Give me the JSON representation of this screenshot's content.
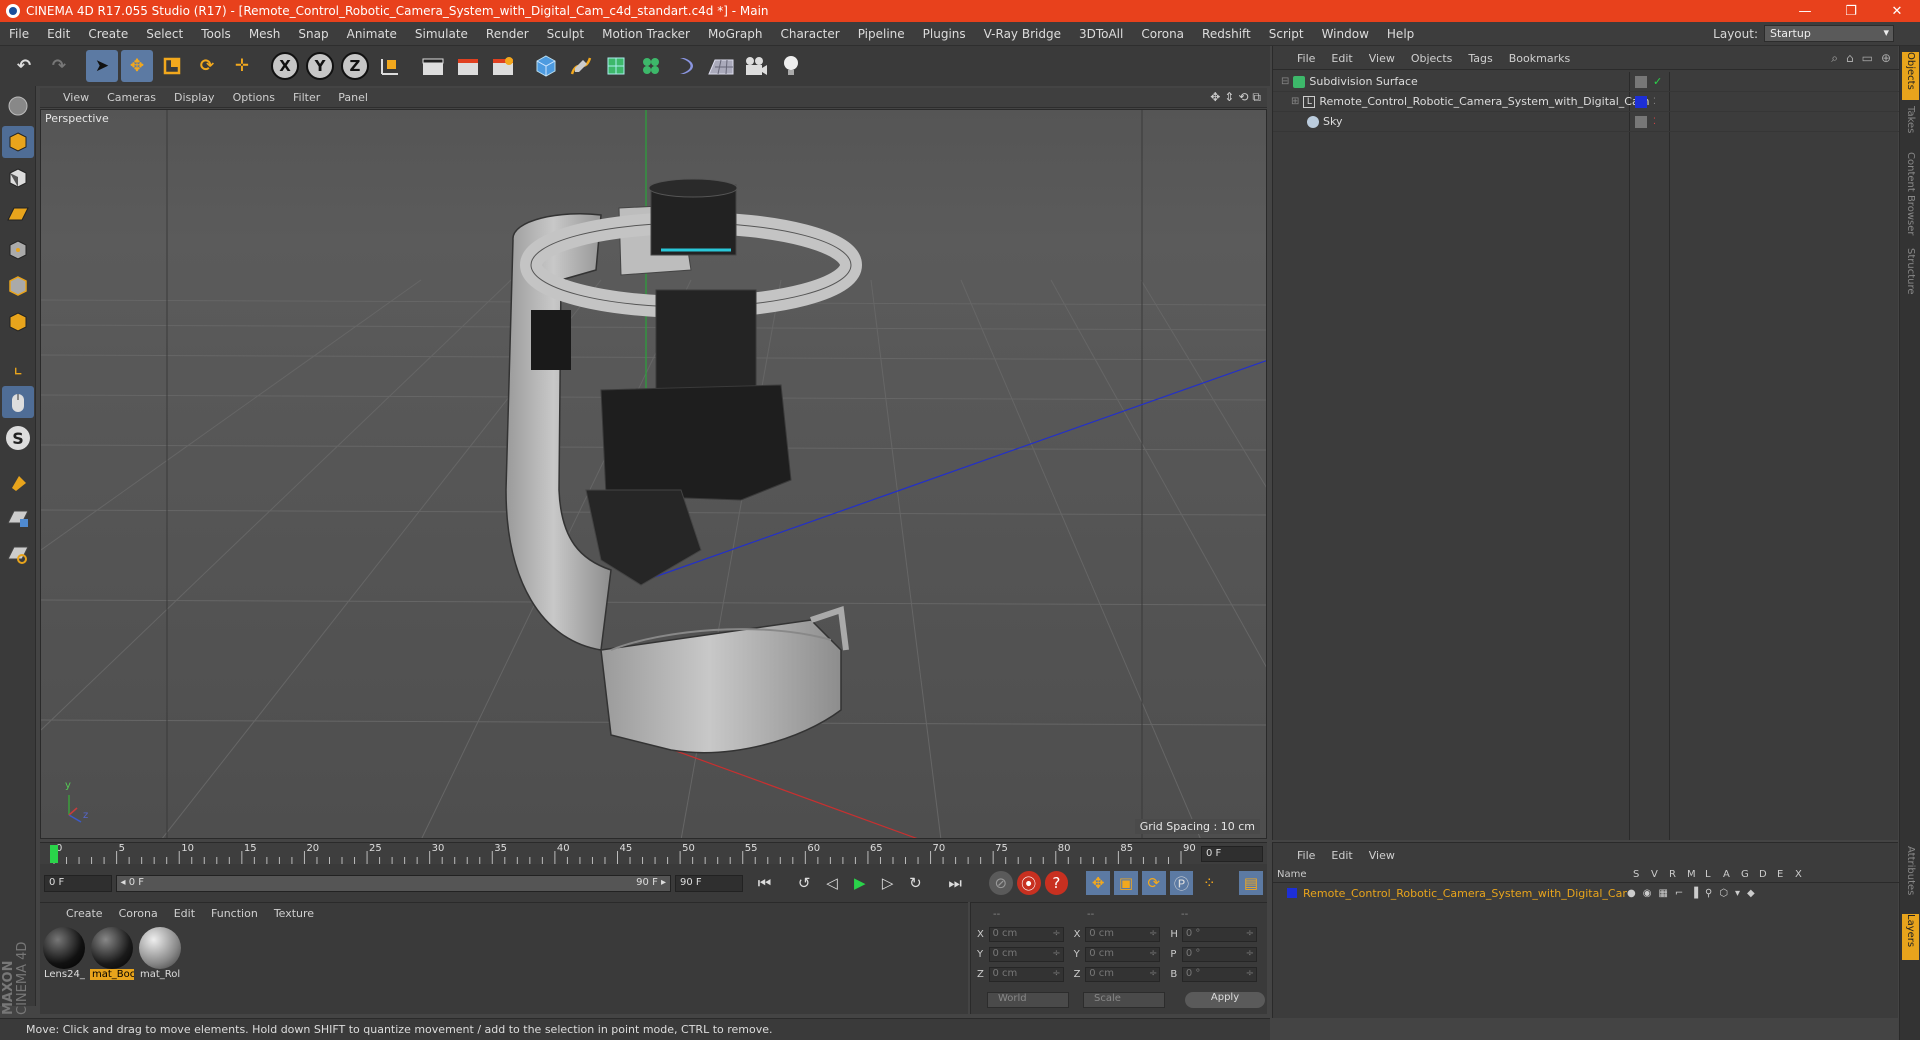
{
  "window": {
    "title": "CINEMA 4D R17.055 Studio (R17) - [Remote_Control_Robotic_Camera_System_with_Digital_Cam_c4d_standart.c4d *] - Main",
    "minimize": "—",
    "restore": "❐",
    "close": "✕"
  },
  "menu": [
    "File",
    "Edit",
    "Create",
    "Select",
    "Tools",
    "Mesh",
    "Snap",
    "Animate",
    "Simulate",
    "Render",
    "Sculpt",
    "Motion Tracker",
    "MoGraph",
    "Character",
    "Pipeline",
    "Plugins",
    "V-Ray Bridge",
    "3DToAll",
    "Corona",
    "Redshift",
    "Script",
    "Window",
    "Help"
  ],
  "layout": {
    "label": "Layout:",
    "value": "Startup"
  },
  "toolbar": {
    "axis_x": "X",
    "axis_y": "Y",
    "axis_z": "Z"
  },
  "viewport": {
    "menu": [
      "View",
      "Cameras",
      "Display",
      "Options",
      "Filter",
      "Panel"
    ],
    "label": "Perspective",
    "grid_spacing": "Grid Spacing : 10 cm",
    "axis_y": "y",
    "axis_z": "z"
  },
  "timeline": {
    "ticks": [
      "0",
      "5",
      "10",
      "15",
      "20",
      "25",
      "30",
      "35",
      "40",
      "45",
      "50",
      "55",
      "60",
      "65",
      "70",
      "75",
      "80",
      "85",
      "90"
    ],
    "current_frame": "0 F"
  },
  "playbar": {
    "start_field": "0 F",
    "slider_start": "◂ 0 F",
    "slider_end": "90 F ▸",
    "end_field": "90 F"
  },
  "materials": {
    "menu": [
      "Create",
      "Corona",
      "Edit",
      "Function",
      "Texture"
    ],
    "items": [
      {
        "name": "Lens24_",
        "selected": false
      },
      {
        "name": "mat_Boc",
        "selected": true
      },
      {
        "name": "mat_Rol",
        "selected": false
      }
    ]
  },
  "coords": {
    "header": [
      "--",
      "--",
      "--"
    ],
    "rows": [
      {
        "a_label": "X",
        "a_val": "0 cm",
        "b_label": "X",
        "b_val": "0 cm",
        "c_label": "H",
        "c_val": "0 °"
      },
      {
        "a_label": "Y",
        "a_val": "0 cm",
        "b_label": "Y",
        "b_val": "0 cm",
        "c_label": "P",
        "c_val": "0 °"
      },
      {
        "a_label": "Z",
        "a_val": "0 cm",
        "b_label": "Z",
        "b_val": "0 cm",
        "c_label": "B",
        "c_val": "0 °"
      }
    ],
    "world": "World",
    "scale": "Scale",
    "apply": "Apply"
  },
  "status": "Move: Click and drag to move elements. Hold down SHIFT to quantize movement / add to the selection in point mode, CTRL to remove.",
  "objects": {
    "menu": [
      "File",
      "Edit",
      "View",
      "Objects",
      "Tags",
      "Bookmarks"
    ],
    "rows": [
      {
        "name": "Subdivision Surface",
        "indent": 8
      },
      {
        "name": "Remote_Control_Robotic_Camera_System_with_Digital_Cam",
        "indent": 18
      },
      {
        "name": "Sky",
        "indent": 18
      }
    ]
  },
  "layers": {
    "menu": [
      "File",
      "Edit",
      "View"
    ],
    "header_name": "Name",
    "cols": [
      "S",
      "V",
      "R",
      "M",
      "L",
      "A",
      "G",
      "D",
      "E",
      "X"
    ],
    "row": "Remote_Control_Robotic_Camera_System_with_Digital_Cam"
  },
  "maxon": {
    "brand": "MAXON",
    "product": "CINEMA 4D"
  },
  "sidetabs": [
    "Objects",
    "Takes",
    "Content Browser",
    "Structure",
    "Attributes",
    "Layers"
  ],
  "colors": {
    "accent": "#e8411c",
    "selection": "#e8a41c",
    "tool_active": "#5c7aa3"
  }
}
